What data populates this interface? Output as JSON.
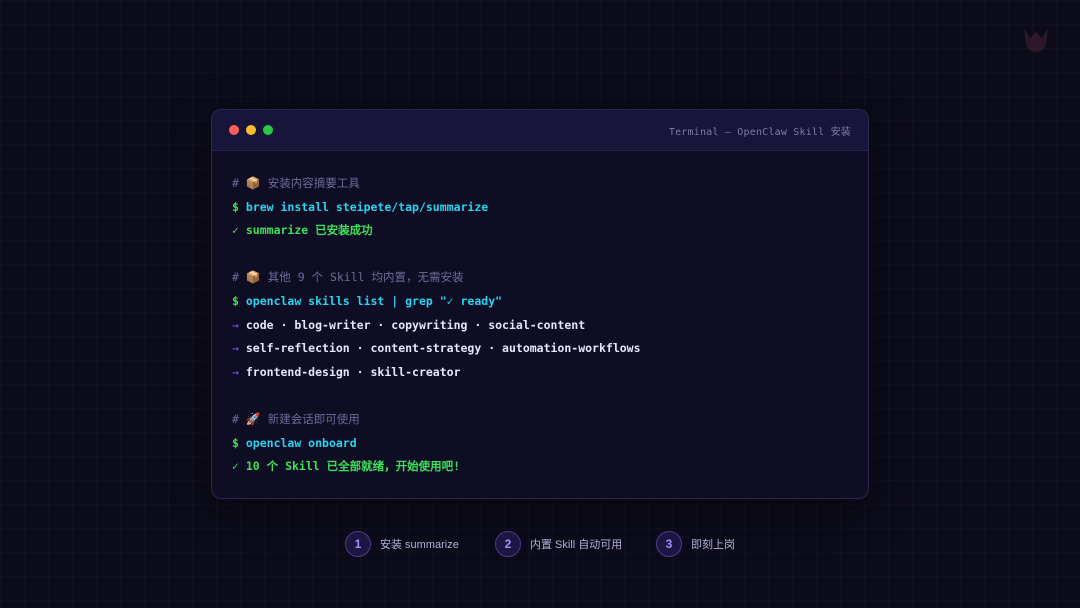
{
  "window": {
    "title": "Terminal — OpenClaw Skill 安装",
    "controls": [
      "close",
      "minimize",
      "maximize"
    ]
  },
  "terminal": {
    "block1": {
      "comment_hash": "#",
      "comment_icon": "📦",
      "comment_text": "安装内容摘要工具",
      "prompt": "$",
      "command": "brew install steipete/tap/summarize",
      "ok_mark": "✓",
      "ok_text": "summarize 已安装成功"
    },
    "block2": {
      "comment_hash": "#",
      "comment_icon": "📦",
      "comment_text": "其他 9 个 Skill 均内置，无需安装",
      "prompt": "$",
      "command": "openclaw skills list | grep \"✓ ready\"",
      "arrow": "→",
      "lines": [
        "code · blog-writer · copywriting · social-content",
        "self-reflection · content-strategy · automation-workflows",
        "frontend-design · skill-creator"
      ]
    },
    "block3": {
      "comment_hash": "#",
      "comment_icon": "🚀",
      "comment_text": "新建会话即可使用",
      "prompt": "$",
      "command": "openclaw onboard",
      "ok_mark": "✓",
      "ok_text": "10 个 Skill 已全部就绪，开始使用吧!"
    }
  },
  "steps": [
    {
      "num": "1",
      "label": "安装 summarize"
    },
    {
      "num": "2",
      "label": "内置 Skill 自动可用"
    },
    {
      "num": "3",
      "label": "即刻上岗"
    }
  ],
  "colors": {
    "background": "#0c0b1a",
    "command": "#2ad4f0",
    "success": "#3ee05a",
    "comment": "#6e6a95",
    "accent": "#8a5cf6"
  }
}
